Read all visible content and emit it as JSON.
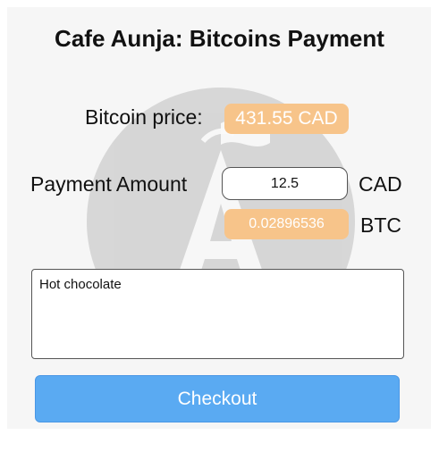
{
  "header": {
    "title": "Cafe Aunja: Bitcoins Payment"
  },
  "price": {
    "label": "Bitcoin price:",
    "value": "431.55 CAD"
  },
  "payment": {
    "label": "Payment Amount",
    "amount_value": "12.5",
    "currency_unit": "CAD",
    "btc_value": "0.02896536",
    "btc_unit": "BTC"
  },
  "note": {
    "value": "Hot chocolate"
  },
  "actions": {
    "checkout_label": "Checkout"
  },
  "colors": {
    "pill_bg": "#f7c48a",
    "button_bg": "#5aaaf2",
    "logo_bg": "#bdbdbd"
  },
  "icons": {
    "background_logo": "cafe-aunja-logo"
  }
}
